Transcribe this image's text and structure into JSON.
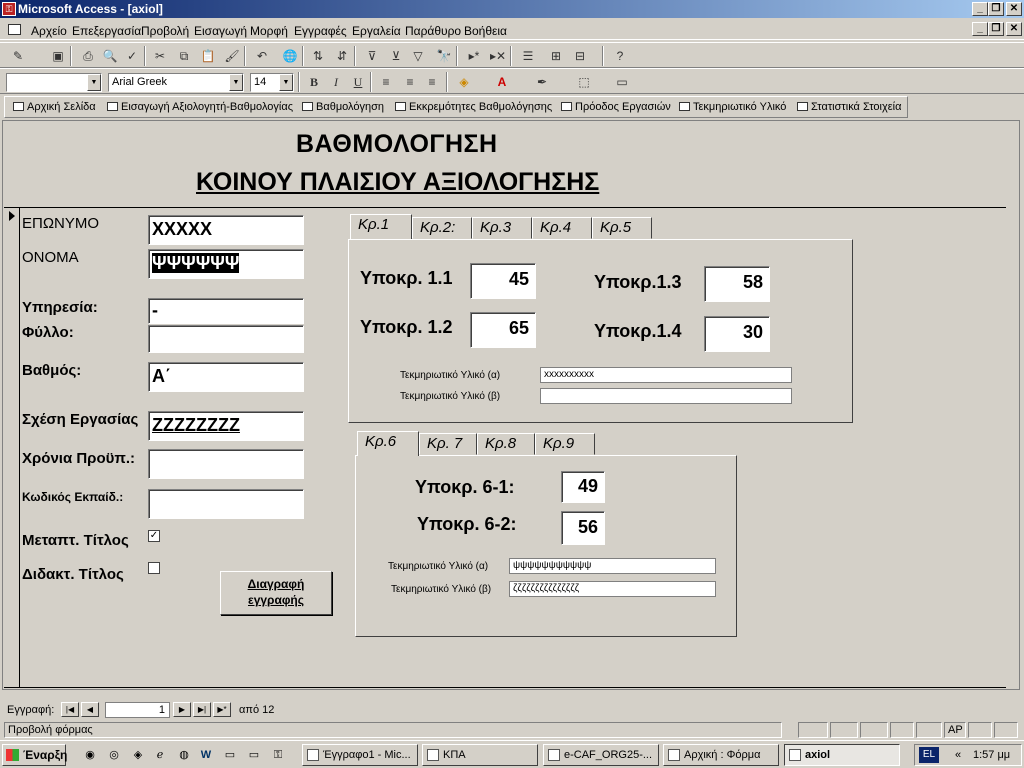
{
  "window": {
    "title": "Microsoft Access - [axiol]",
    "icon": "access-key-icon"
  },
  "menu": [
    "Αρχείο",
    "Επεξεργασία",
    "Προβολή",
    "Εισαγωγή",
    "Μορφή",
    "Εγγραφές",
    "Εργαλεία",
    "Παράθυρο",
    "Βοήθεια"
  ],
  "formatting": {
    "font_name": "Arial Greek",
    "font_size": "14",
    "object": ""
  },
  "switchboard": [
    "Αρχική Σελίδα",
    "Εισαγωγή Αξιολογητή-Βαθμολογίας",
    "Βαθμολόγηση",
    "Εκκρεμότητες Βαθμολόγησης",
    "Πρόοδος Εργασιών",
    "Τεκμηριωτικό Υλικό",
    "Στατιστικά Στοιχεία"
  ],
  "form": {
    "title1": "ΒΑΘΜΟΛΟΓΗΣΗ",
    "title2": "ΚΟΙΝΟΥ ΠΛΑΙΣΙΟΥ ΑΞΙΟΛΟΓΗΣΗΣ",
    "surname_label": "ΕΠΩΝΥΜΟ",
    "surname": "XXXXX",
    "name_label": "ΟΝΟΜΑ",
    "name": "ΨΨΨΨΨΨ",
    "service_label": "Υπηρεσία:",
    "service": "-",
    "gender_label": "Φύλλο:",
    "gender": "",
    "grade_label": "Βαθμός:",
    "grade": "Α΄",
    "employment_label": "Σχέση Εργασίας",
    "employment": "ZZZZZZZZ",
    "years_label": "Χρόνια Προϋπ.:",
    "years": "",
    "edu_label": "Κωδικός Εκπαίδ.:",
    "edu": "",
    "postgrad_label": "Μεταπτ. Τίτλος",
    "postgrad_checked": "✓",
    "phd_label": "Διδακτ. Τίτλος",
    "phd_checked": "",
    "delete_line1": "Διαγραφή",
    "delete_line2": "εγγραφής"
  },
  "tabs1": {
    "labels": [
      "Κρ.1",
      "Κρ.2:",
      "Κρ.3",
      "Κρ.4",
      "Κρ.5"
    ],
    "sub11_label": "Υποκρ. 1.1",
    "sub11": "45",
    "sub12_label": "Υποκρ. 1.2",
    "sub12": "65",
    "sub13_label": "Υποκρ.1.3",
    "sub13": "58",
    "sub14_label": "Υποκρ.1.4",
    "sub14": "30",
    "mat_a_label": "Τεκμηριωτικό Υλικό (α)",
    "mat_a": "xxxxxxxxxx",
    "mat_b_label": "Τεκμηριωτικό Υλικό (β)",
    "mat_b": ""
  },
  "tabs2": {
    "labels": [
      "Κρ.6",
      "Κρ. 7",
      "Κρ.8",
      "Κρ.9"
    ],
    "sub61_label": "Υποκρ. 6-1:",
    "sub61": "49",
    "sub62_label": "Υποκρ. 6-2:",
    "sub62": "56",
    "mat_a_label": "Τεκμηριωτικό Υλικό (α)",
    "mat_a": "ψψψψψψψψψψψ",
    "mat_b_label": "Τεκμηριωτικό Υλικό (β)",
    "mat_b": "ζζζζζζζζζζζζζζζ"
  },
  "navigator": {
    "label": "Εγγραφή:",
    "current": "1",
    "of": "από 12"
  },
  "status": {
    "text": "Προβολή φόρμας",
    "ap": "AP"
  },
  "taskbar": {
    "start": "Έναρξη",
    "tasks": [
      "Έγγραφο1 - Mic...",
      "ΚΠΑ",
      "e-CAF_ORG25-...",
      "Αρχική : Φόρμα",
      "axiol"
    ],
    "lang": "EL",
    "clock": "1:57 μμ"
  }
}
